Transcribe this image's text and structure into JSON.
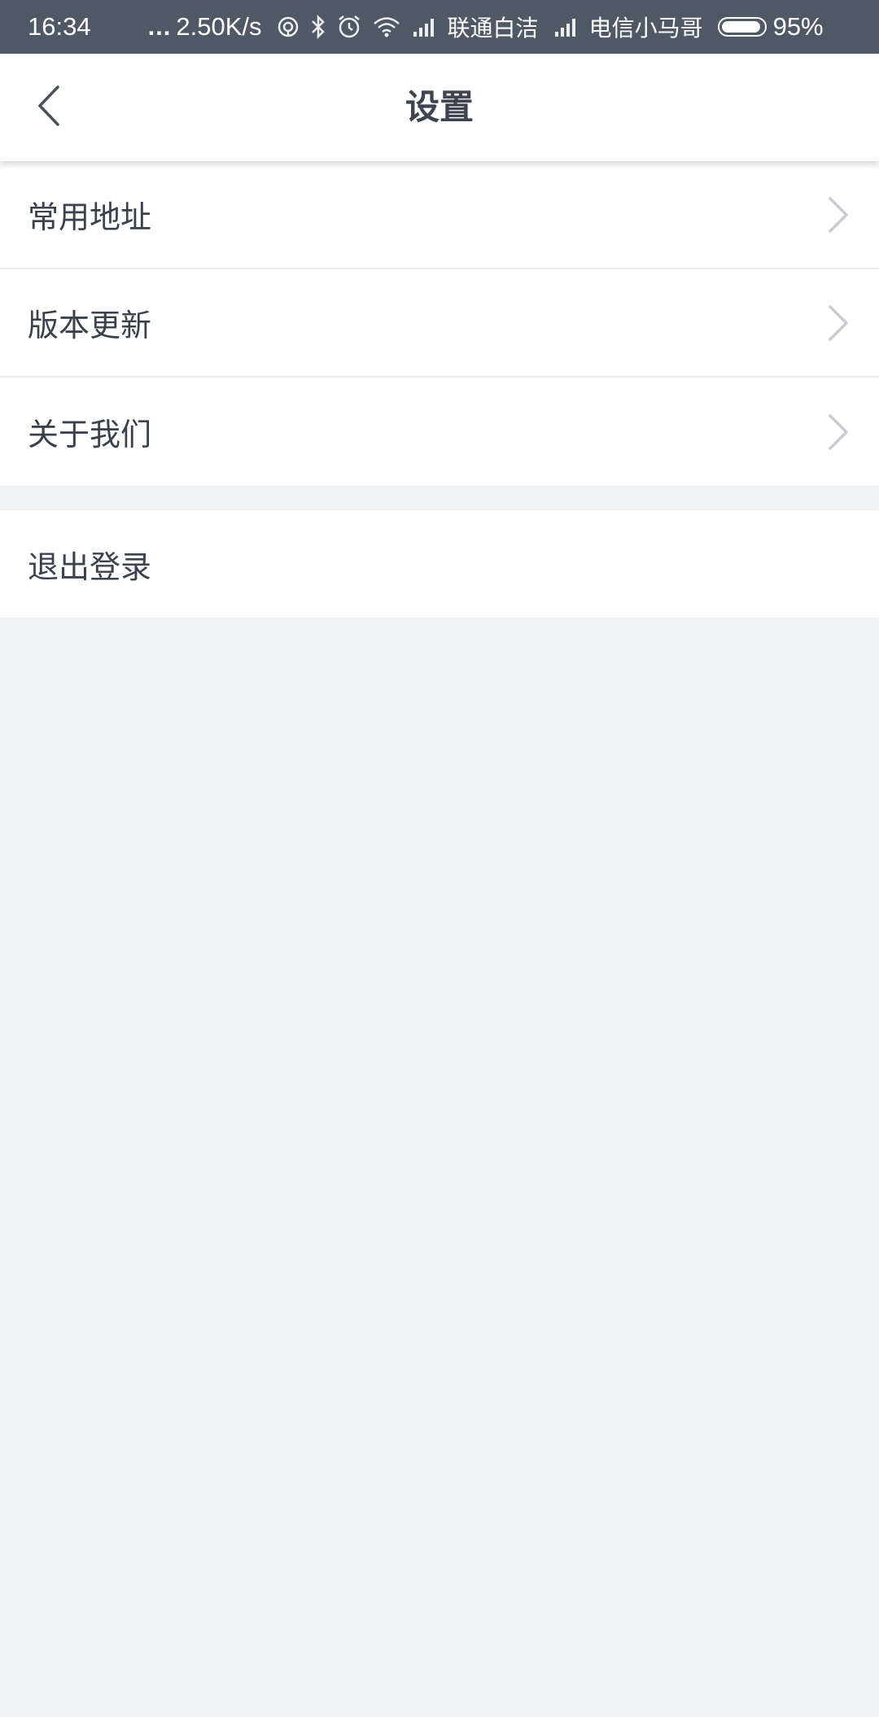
{
  "status_bar": {
    "time": "16:34",
    "dots": "...",
    "speed": "2.50K/s",
    "carrier1": "联通白洁",
    "carrier2": "电信小马哥",
    "battery": "95%"
  },
  "header": {
    "title": "设置",
    "back_icon": "chevron-left-icon"
  },
  "menu": {
    "items": [
      {
        "label": "常用地址",
        "icon": "chevron-right-icon"
      },
      {
        "label": "版本更新",
        "icon": "chevron-right-icon"
      },
      {
        "label": "关于我们",
        "icon": "chevron-right-icon"
      }
    ]
  },
  "logout": {
    "label": "退出登录"
  },
  "colors": {
    "status_bar_bg": "#4f5966",
    "page_bg": "#f1f2f4",
    "text": "#3c424d",
    "chevron": "#c8ccd2"
  }
}
